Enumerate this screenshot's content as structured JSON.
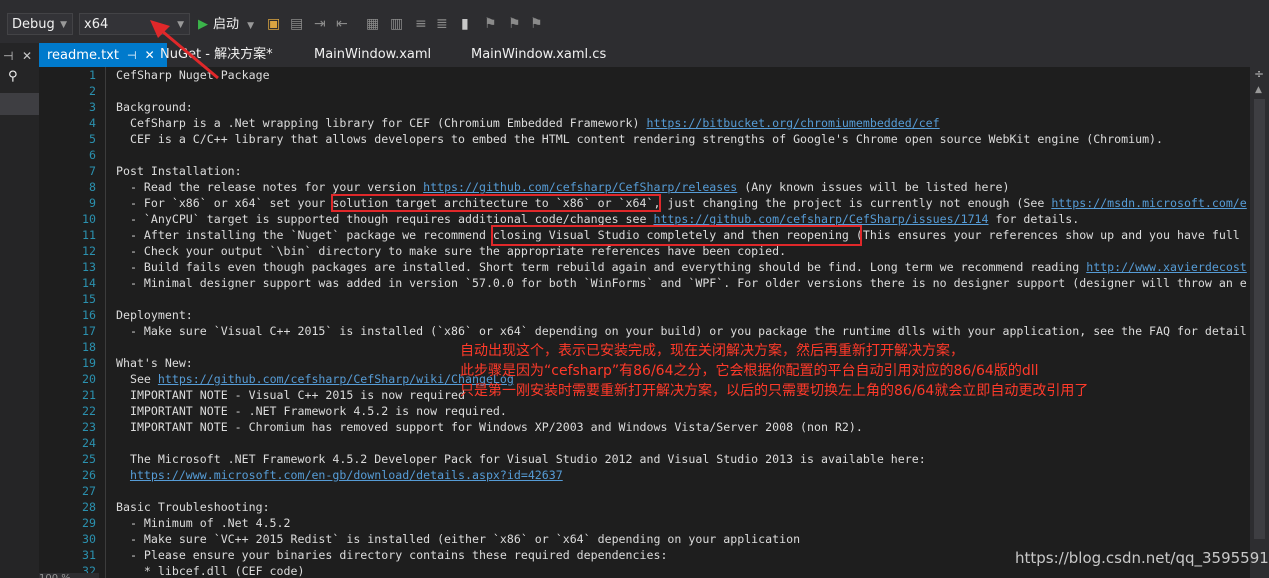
{
  "toolbar": {
    "config_value": "Debug",
    "platform_value": "x64",
    "start_label": "启动"
  },
  "tabs": [
    {
      "label": "readme.txt",
      "active": true
    },
    {
      "label": "NuGet - 解决方案*"
    },
    {
      "label": "MainWindow.xaml"
    },
    {
      "label": "MainWindow.xaml.cs"
    }
  ],
  "editor": {
    "lines": [
      {
        "n": "1",
        "text": "CefSharp Nuget Package"
      },
      {
        "n": "2",
        "text": ""
      },
      {
        "n": "3",
        "text": "Background:"
      },
      {
        "n": "4",
        "text": "  CefSharp is a .Net wrapping library for CEF (Chromium Embedded Framework) ",
        "link": "https://bitbucket.org/chromiumembedded/cef"
      },
      {
        "n": "5",
        "text": "  CEF is a C/C++ library that allows developers to embed the HTML content rendering strengths of Google's Chrome open source WebKit engine (Chromium)."
      },
      {
        "n": "6",
        "text": ""
      },
      {
        "n": "7",
        "text": "Post Installation:"
      },
      {
        "n": "8",
        "text": "  - Read the release notes for your version ",
        "link": "https://github.com/cefsharp/CefSharp/releases",
        "after": " (Any known issues will be listed here)"
      },
      {
        "n": "9",
        "text": "  - For `x86` or x64` set your solution target architecture to `x86` or `x64`, just changing the project is currently not enough (See ",
        "link": "https://msdn.microsoft.com/e"
      },
      {
        "n": "10",
        "text": "  - `AnyCPU` target is supported though requires additional code/changes see ",
        "link": "https://github.com/cefsharp/CefSharp/issues/1714",
        "after": " for details."
      },
      {
        "n": "11",
        "text": "  - After installing the `Nuget` package we recommend closing Visual Studio completely and then reopening (This ensures your references show up and you have full"
      },
      {
        "n": "12",
        "text": "  - Check your output `\\bin` directory to make sure the appropriate references have been copied."
      },
      {
        "n": "13",
        "text": "  - Build fails even though packages are installed. Short term rebuild again and everything should be find. Long term we recommend reading ",
        "link": "http://www.xavierdecost"
      },
      {
        "n": "14",
        "text": "  - Minimal designer support was added in version `57.0.0 for both `WinForms` and `WPF`. For older versions there is no designer support (designer will throw an e"
      },
      {
        "n": "15",
        "text": ""
      },
      {
        "n": "16",
        "text": "Deployment:"
      },
      {
        "n": "17",
        "text": "  - Make sure `Visual C++ 2015` is installed (`x86` or x64` depending on your build) or you package the runtime dlls with your application, see the FAQ for detail"
      },
      {
        "n": "18",
        "text": ""
      },
      {
        "n": "19",
        "text": "What's New:"
      },
      {
        "n": "20",
        "text": "  See ",
        "link": "https://github.com/cefsharp/CefSharp/wiki/ChangeLog"
      },
      {
        "n": "21",
        "text": "  IMPORTANT NOTE - Visual C++ 2015 is now required"
      },
      {
        "n": "22",
        "text": "  IMPORTANT NOTE - .NET Framework 4.5.2 is now required."
      },
      {
        "n": "23",
        "text": "  IMPORTANT NOTE - Chromium has removed support for Windows XP/2003 and Windows Vista/Server 2008 (non R2)."
      },
      {
        "n": "24",
        "text": ""
      },
      {
        "n": "25",
        "text": "  The Microsoft .NET Framework 4.5.2 Developer Pack for Visual Studio 2012 and Visual Studio 2013 is available here:"
      },
      {
        "n": "26",
        "text": "  ",
        "link": "https://www.microsoft.com/en-gb/download/details.aspx?id=42637"
      },
      {
        "n": "27",
        "text": ""
      },
      {
        "n": "28",
        "text": "Basic Troubleshooting:"
      },
      {
        "n": "29",
        "text": "  - Minimum of .Net 4.5.2"
      },
      {
        "n": "30",
        "text": "  - Make sure `VC++ 2015 Redist` is installed (either `x86` or `x64` depending on your application"
      },
      {
        "n": "31",
        "text": "  - Please ensure your binaries directory contains these required dependencies:"
      },
      {
        "n": "32",
        "text": "    * libcef.dll (CEF code)"
      }
    ]
  },
  "annotations": [
    "自动出现这个，表示已安装完成，现在关闭解决方案，然后再重新打开解决方案，",
    "此步骤是因为“cefsharp”有86/64之分，它会根据你配置的平台自动引用对应的86/64版的dll",
    "只是第一刚安装时需要重新打开解决方案，以后的只需要切换左上角的86/64就会立即自动更改引用了"
  ],
  "watermark": "https://blog.csdn.net/qq_35955916",
  "status": {
    "zoom": "100 %"
  },
  "colors": {
    "annotation": "#ff3a2a",
    "accent": "#007acc",
    "link": "#569cd6",
    "line_number": "#2b91af"
  }
}
